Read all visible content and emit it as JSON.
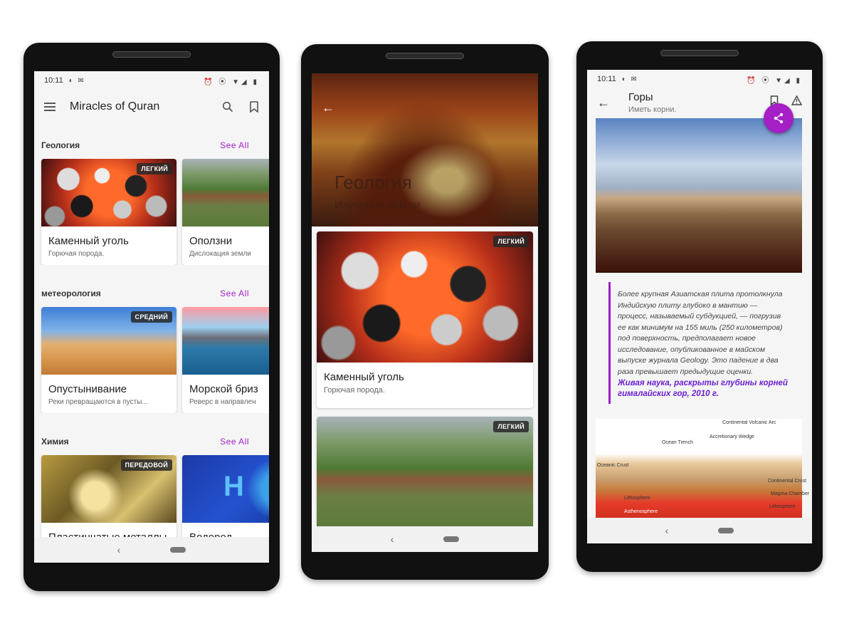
{
  "phone1": {
    "status": {
      "time": "10:11",
      "left_icons": "◐ ✉",
      "right_icons": "⏰ ⦿ ▼◢ ▮"
    },
    "app_title": "Miracles of Quran",
    "sections": [
      {
        "title": "Геология",
        "see_all": "See All",
        "cards": [
          {
            "title": "Каменный уголь",
            "subtitle": "Горючая порода.",
            "badge": "ЛЕГКИЙ"
          },
          {
            "title": "Оползни",
            "subtitle": "Дислокация земли",
            "badge": ""
          }
        ]
      },
      {
        "title": "метеорология",
        "see_all": "See All",
        "cards": [
          {
            "title": "Опустынивание",
            "subtitle": "Реки превращаются в пусты...",
            "badge": "СРЕДНИЙ"
          },
          {
            "title": "Морской бриз",
            "subtitle": "Реверс в направлен",
            "badge": ""
          }
        ]
      },
      {
        "title": "Химия",
        "see_all": "See All",
        "cards": [
          {
            "title": "Пластинчатые металлы",
            "subtitle": "",
            "badge": "ПЕРЕДОВОЙ"
          },
          {
            "title": "Водород",
            "subtitle": "",
            "badge": ""
          }
        ]
      }
    ]
  },
  "phone2": {
    "hero_title": "Геология",
    "hero_subtitle": "Изучение земли",
    "cards": [
      {
        "title": "Каменный уголь",
        "subtitle": "Горючая порода.",
        "badge": "ЛЕГКИЙ"
      },
      {
        "badge": "ЛЕГКИЙ"
      }
    ]
  },
  "phone3": {
    "status": {
      "time": "10:11",
      "left_icons": "◐ ✉",
      "right_icons": "⏰ ⦿ ▼◢ ▮"
    },
    "title": "Горы",
    "subtitle": "Иметь корни.",
    "quote": "Более крупная Азиатская плита протолкнула Индийскую плиту глубоко в мантию — процесс, называемый субдукцией, — погрузив ее как минимум на 155 миль (250 километров) под поверхность, предполагает новое исследование, опубликованное в майском выпуске журнала Geology. Это падение в два раза превышает предыдущие оценки.",
    "source": "Живая наука, раскрыты глубины корней гималайских гор, 2010 г.",
    "diagram_labels": {
      "volcanic_arc": "Continental Volcanic Arc",
      "ocean_trench": "Ocean Trench",
      "accretionary_wedge": "Accretionary Wedge",
      "oceanic_crust": "Oceanic Crust",
      "continental_crust": "Continental Crust",
      "magma_chamber": "Magma Chamber",
      "lithosphere_left": "Lithosphere",
      "lithosphere_right": "Lithosphere",
      "asthenosphere": "Asthenosphere"
    }
  },
  "colors": {
    "accent": "#a020c8",
    "fab": "#a51ec6",
    "source_text": "#6a1fd1"
  }
}
